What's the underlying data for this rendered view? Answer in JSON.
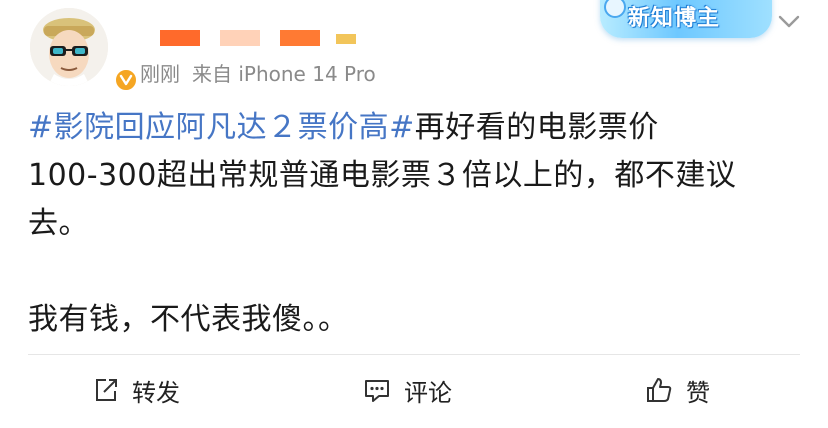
{
  "post": {
    "author": {
      "name_redacted": true,
      "verified": true
    },
    "meta": {
      "time": "刚刚",
      "source": "来自 iPhone 14 Pro"
    },
    "badge": {
      "label": "新知博主"
    },
    "content": {
      "topic": "#影院回应阿凡达２票价高#",
      "line1_rest": "再好看的电影票价",
      "line2": "100-300超出常规普通电影票３倍以上的，都不建议",
      "line3": "去。",
      "para2": "我有钱，不代表我傻。。"
    },
    "actions": {
      "repost": "转发",
      "comment": "评论",
      "like": "赞"
    }
  },
  "colors": {
    "topic_link": "#4676c5",
    "meta_text": "#8a8a8a",
    "verified_badge": "#f5a623"
  }
}
